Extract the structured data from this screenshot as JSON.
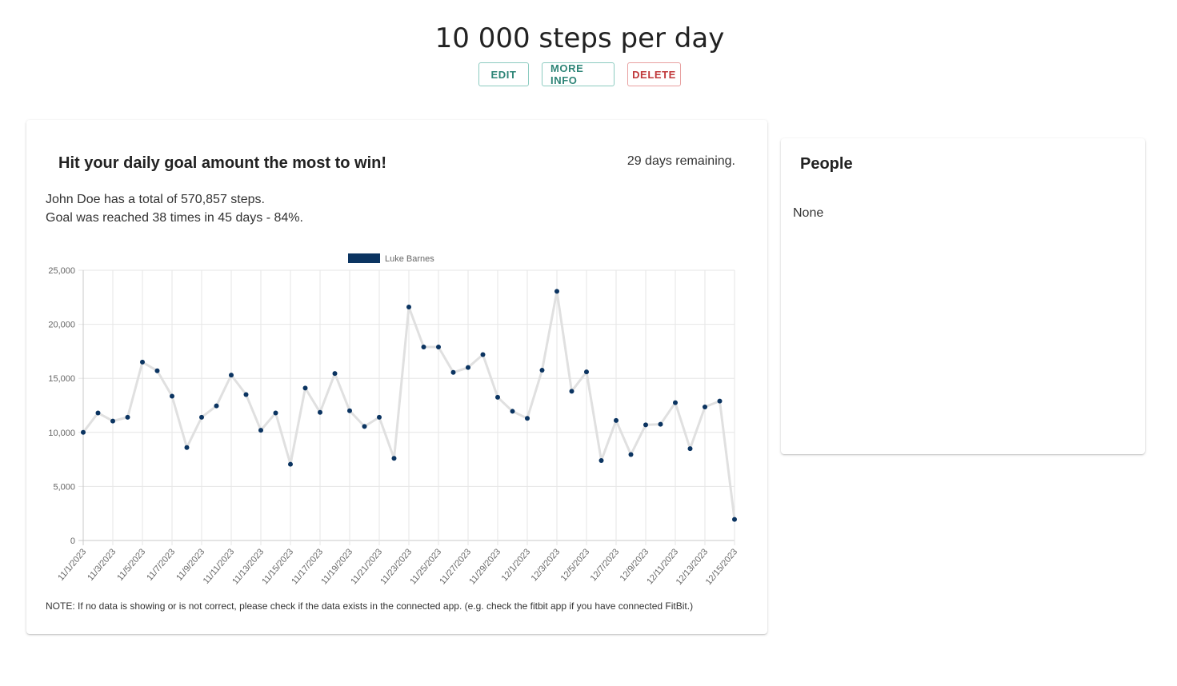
{
  "header": {
    "title": "10 000 steps per day",
    "buttons": {
      "edit": "EDIT",
      "more_info": "MORE INFO",
      "delete": "DELETE"
    }
  },
  "challenge": {
    "heading": "Hit your daily goal amount the most to win!",
    "remaining": "29 days remaining.",
    "summary_line1": "John Doe has a total of 570,857 steps.",
    "summary_line2": "Goal was reached 38 times in 45 days - 84%.",
    "note": "NOTE: If no data is showing or is not correct, please check if the data exists in the connected app. (e.g. check the fitbit app if you have connected FitBit.)"
  },
  "people": {
    "title": "People",
    "empty_text": "None"
  },
  "colors": {
    "teal": "#2e8577",
    "red": "#c0393b",
    "point": "#0b3461",
    "line": "#e0e0e0",
    "legend": "#0b3461"
  },
  "chart_data": {
    "type": "line",
    "legend": [
      "Luke Barnes"
    ],
    "legend_position": "top",
    "grid": true,
    "ylim": [
      0,
      25000
    ],
    "yticks": [
      "0",
      "5,000",
      "10,000",
      "15,000",
      "20,000",
      "25,000"
    ],
    "xticks": [
      "11/1/2023",
      "11/3/2023",
      "11/5/2023",
      "11/7/2023",
      "11/9/2023",
      "11/11/2023",
      "11/13/2023",
      "11/15/2023",
      "11/17/2023",
      "11/19/2023",
      "11/21/2023",
      "11/23/2023",
      "11/25/2023",
      "11/27/2023",
      "11/29/2023",
      "12/1/2023",
      "12/3/2023",
      "12/5/2023",
      "12/7/2023",
      "12/9/2023",
      "12/11/2023",
      "12/13/2023",
      "12/15/2023"
    ],
    "series": [
      {
        "name": "Luke Barnes",
        "values": [
          10000,
          11800,
          11050,
          11400,
          16500,
          15700,
          13350,
          8600,
          11400,
          12450,
          15300,
          13500,
          10200,
          11800,
          7050,
          14100,
          11850,
          15450,
          12000,
          10550,
          11400,
          7600,
          21600,
          17900,
          17900,
          15550,
          16000,
          17200,
          13250,
          11950,
          11300,
          15750,
          23050,
          13800,
          15600,
          7400,
          11100,
          7950,
          10700,
          10750,
          12750,
          8500,
          12350,
          12900,
          1950
        ]
      }
    ]
  }
}
